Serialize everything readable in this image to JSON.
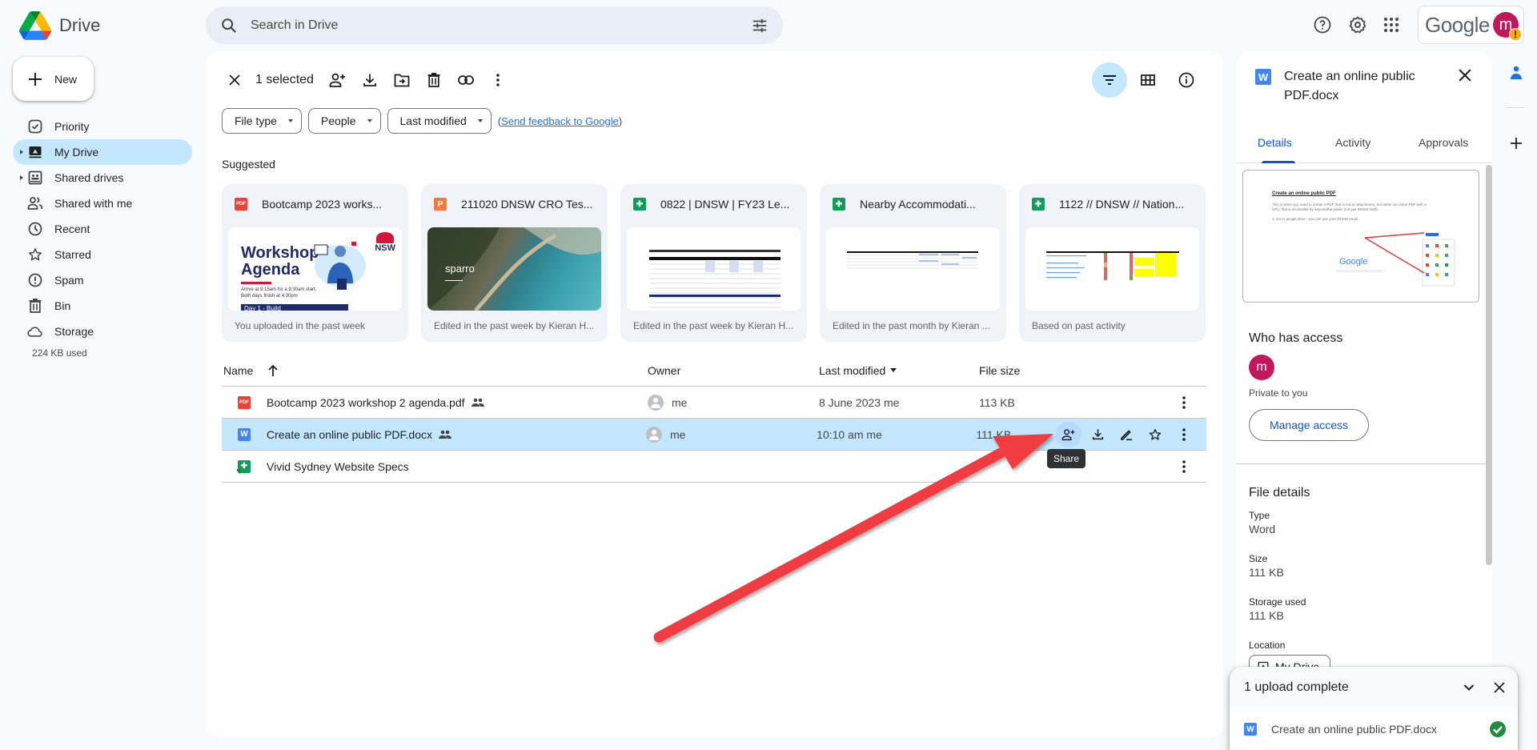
{
  "app": {
    "name": "Drive"
  },
  "header": {
    "search_placeholder": "Search in Drive",
    "google_wordmark": "Google",
    "account_initial": "m",
    "account_warning": "!"
  },
  "sidebar": {
    "new_label": "New",
    "items": [
      {
        "label": "Priority",
        "icon": "priority-icon"
      },
      {
        "label": "My Drive",
        "icon": "my-drive-icon",
        "active": true
      },
      {
        "label": "Shared drives",
        "icon": "shared-drives-icon"
      },
      {
        "label": "Shared with me",
        "icon": "shared-with-me-icon"
      },
      {
        "label": "Recent",
        "icon": "clock-icon"
      },
      {
        "label": "Starred",
        "icon": "star-icon"
      },
      {
        "label": "Spam",
        "icon": "spam-icon"
      },
      {
        "label": "Bin",
        "icon": "trash-icon"
      },
      {
        "label": "Storage",
        "icon": "cloud-icon"
      }
    ],
    "storage_used": "224 KB used"
  },
  "toolbar": {
    "selected_count": "1 selected"
  },
  "filters": {
    "chips": [
      "File type",
      "People",
      "Last modified"
    ],
    "feedback_open": "(",
    "feedback_link": "Send feedback to Google",
    "feedback_close": ")"
  },
  "suggested": {
    "label": "Suggested",
    "cards": [
      {
        "title": "Bootcamp 2023 works...",
        "type": "pdf",
        "footer": "You uploaded in the past week",
        "thumb_title_1": "Workshop 2",
        "thumb_title_2": "Agenda",
        "thumb_line_1": "Arrive at 9:15am for a 9:30am start.",
        "thumb_line_2": "Both days finish at 4:30pm",
        "thumb_bar": "Day 1 - Build",
        "thumb_badge": "NSW"
      },
      {
        "title": "211020 DNSW CRO Tes...",
        "type": "slides",
        "footer": "Edited in the past week by Kieran H...",
        "thumb_brand": "sparro"
      },
      {
        "title": "0822 | DNSW | FY23 Le...",
        "type": "sheet",
        "footer": "Edited in the past week by Kieran H..."
      },
      {
        "title": "Nearby Accommodati...",
        "type": "sheet",
        "footer": "Edited in the past month by Kieran ..."
      },
      {
        "title": "1122 // DNSW // Nation...",
        "type": "sheet",
        "footer": "Based on past activity"
      }
    ]
  },
  "list": {
    "columns": {
      "name": "Name",
      "owner": "Owner",
      "modified": "Last modified",
      "size": "File size"
    },
    "rows": [
      {
        "name": "Bootcamp 2023 workshop 2 agenda.pdf",
        "type": "pdf",
        "shared": true,
        "owner": "me",
        "modified": "8 June 2023  me",
        "size": "113 KB",
        "selected": false
      },
      {
        "name": "Create an online public PDF.docx",
        "type": "word",
        "shared": true,
        "owner": "me",
        "modified": "10:10 am  me",
        "size": "111 KB",
        "selected": true
      },
      {
        "name": "Vivid Sydney Website Specs",
        "type": "sheet-shortcut",
        "shared": false,
        "owner": "",
        "modified": "",
        "size": "",
        "selected": false
      }
    ],
    "tooltip": "Share"
  },
  "details": {
    "title": "Create an online public PDF.docx",
    "tabs": [
      "Details",
      "Activity",
      "Approvals"
    ],
    "active_tab": "Details",
    "preview": {
      "heading": "Create an online public PDF",
      "line1": "This is when you need to create a PDF that is not an attachment, but rather an online PDF with a",
      "line2": "URL, that is accessible by anyone/the public (not just DNSW staff)",
      "line3": "1. Go to google drive - you can use your DNSW email",
      "logo": "Google"
    },
    "access_title": "Who has access",
    "access_initial": "m",
    "access_status": "Private to you",
    "manage_access": "Manage access",
    "file_details_title": "File details",
    "fields": [
      {
        "label": "Type",
        "value": "Word"
      },
      {
        "label": "Size",
        "value": "111 KB"
      },
      {
        "label": "Storage used",
        "value": "111 KB"
      },
      {
        "label": "Location",
        "value": "My Drive"
      }
    ]
  },
  "upload_toast": {
    "title": "1 upload complete",
    "file": "Create an online public PDF.docx",
    "status": "complete"
  },
  "colors": {
    "accent": "#0b57d0",
    "selected_row": "#c2e7ff",
    "annotation_arrow": "#f03a3f",
    "avatar": "#c2185b"
  }
}
